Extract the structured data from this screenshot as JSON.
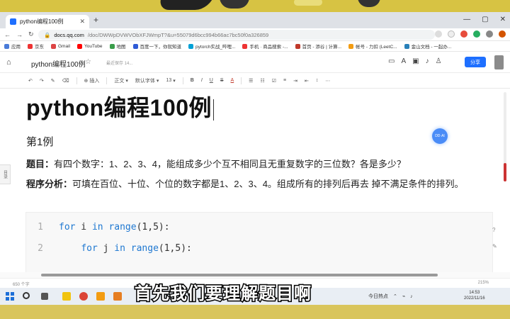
{
  "browser": {
    "tab_title": "python编程100例",
    "new_tab": "+",
    "url_host": "docs.qq.com",
    "url_path": "/doc/DWWpDVWVObXFJWmpT?&u=55079d6bcc994b66ac7bc50f0a326859",
    "bookmarks": [
      "应用",
      "京东",
      "Gmail",
      "YouTube",
      "地图",
      "百度一下，你就知道",
      "pytorch实战_哔哩...",
      "手机 · 商品搜索 -...",
      "首页 - 添谷 | 计算...",
      "帐号 - 力扣 (LeetC...",
      "金山文档 - 一起办..."
    ]
  },
  "doc_header": {
    "title": "python编程100例",
    "status": "最近保存 14...",
    "share_label": "分享"
  },
  "toolbar": {
    "insert": "插入",
    "style": "正文",
    "font": "默认字体",
    "size": "13"
  },
  "document": {
    "title": "python编程100例",
    "example_heading": "第1例",
    "q_label": "题目：",
    "q_text": "有四个数字：1、2、3、4，能组成多少个互不相同且无重复数字的三位数？各是多少？",
    "analysis_label": "程序分析：",
    "analysis_text": "可填在百位、十位、个位的数字都是1、2、3、4。组成所有的排列后再去 掉不满足条件的排列。",
    "code_lines": [
      {
        "num": "1",
        "indent": "",
        "kw1": "for",
        "var": " i ",
        "kw2": "in",
        "fn": " range",
        "args": "(1,5):"
      },
      {
        "num": "2",
        "indent": "    ",
        "kw1": "for",
        "var": " j ",
        "kw2": "in",
        "fn": " range",
        "args": "(1,5):"
      }
    ],
    "ai_badge": "DD·AI"
  },
  "statusbar": {
    "word_count": "650 个字",
    "zoom": "215%"
  },
  "taskbar": {
    "weather": "今日热点",
    "time": "14:53",
    "date": "2022/11/16"
  },
  "subtitle": "首先我们要理解题目啊",
  "side_tab": "目录"
}
